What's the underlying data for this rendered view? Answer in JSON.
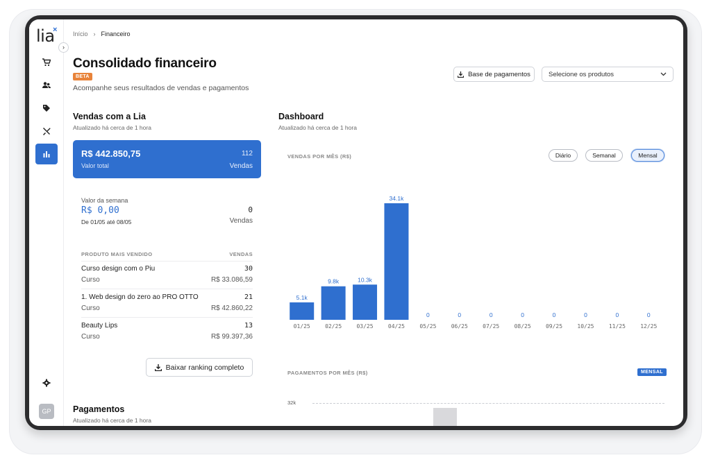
{
  "app": {
    "logo": "lia",
    "logo_mark": "×",
    "accent": "#2f6fcf"
  },
  "sidebar": {
    "items": [
      {
        "id": "cart",
        "icon": "cart-icon"
      },
      {
        "id": "users",
        "icon": "users-icon"
      },
      {
        "id": "tags",
        "icon": "tag-icon"
      },
      {
        "id": "tools",
        "icon": "tools-icon"
      },
      {
        "id": "reports",
        "icon": "bar-chart-icon",
        "active": true
      }
    ],
    "settings_icon": "gear-icon",
    "avatar_initials": "GP"
  },
  "breadcrumb": {
    "home": "Início",
    "current": "Financeiro"
  },
  "header": {
    "title": "Consolidado financeiro",
    "badge": "BETA",
    "subtitle": "Acompanhe seus resultados de vendas e pagamentos",
    "payments_base_button": "Base de pagamentos",
    "products_select_placeholder": "Selecione os produtos"
  },
  "sales": {
    "title": "Vendas com a Lia",
    "updated": "Atualizado há cerca de 1 hora",
    "total_value": "R$ 442.850,75",
    "total_label": "Valor total",
    "total_count": "112",
    "total_count_label": "Vendas",
    "week_label": "Valor da semana",
    "week_value": "R$ 0,00",
    "week_range": "De 01/05 até 08/05",
    "week_count": "0",
    "week_count_label": "Vendas",
    "ranking_header_product": "PRODUTO MAIS VENDIDO",
    "ranking_header_sales": "VENDAS",
    "ranking": [
      {
        "name": "Curso design com o Piu",
        "category": "Curso",
        "qty": "30",
        "amount": "R$ 33.086,59"
      },
      {
        "name": "1. Web design do zero ao PRO OTTO",
        "category": "Curso",
        "qty": "21",
        "amount": "R$ 42.860,22"
      },
      {
        "name": "Beauty Lips",
        "category": "Curso",
        "qty": "13",
        "amount": "R$ 99.397,36"
      }
    ],
    "download_button": "Baixar ranking completo"
  },
  "payments": {
    "title": "Pagamentos",
    "updated": "Atualizado há cerca de 1 hora"
  },
  "dashboard": {
    "title": "Dashboard",
    "updated": "Atualizado há cerca de 1 hora",
    "sales_chart_label": "VENDAS POR MÊS (R$)",
    "period_chips": [
      "Diário",
      "Semanal",
      "Mensal"
    ],
    "active_chip": "Mensal",
    "payments_chart_label": "PAGAMENTOS POR MÊS (R$)",
    "payments_badge": "MENSAL",
    "payments_tick": "32k"
  },
  "chart_data": [
    {
      "type": "bar",
      "title": "VENDAS POR MÊS (R$)",
      "categories": [
        "01/25",
        "02/25",
        "03/25",
        "04/25",
        "05/25",
        "06/25",
        "07/25",
        "08/25",
        "09/25",
        "10/25",
        "11/25",
        "12/25"
      ],
      "values": [
        5100,
        9800,
        10300,
        34100,
        0,
        0,
        0,
        0,
        0,
        0,
        0,
        0
      ],
      "data_labels": [
        "5.1k",
        "9.8k",
        "10.3k",
        "34.1k",
        "0",
        "0",
        "0",
        "0",
        "0",
        "0",
        "0",
        "0"
      ],
      "ylim": [
        0,
        34100
      ],
      "color": "#2f6fcf",
      "grid": false
    }
  ]
}
